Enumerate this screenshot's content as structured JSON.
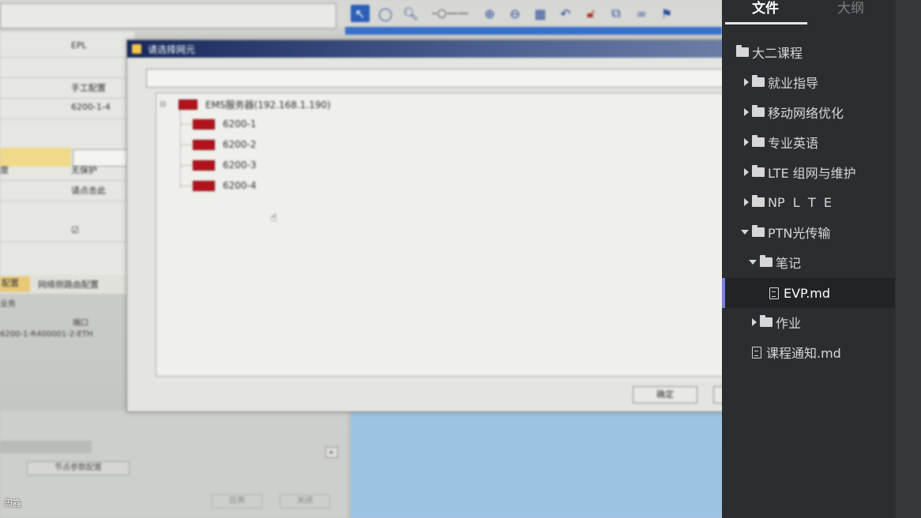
{
  "photo": {
    "left_panel": {
      "rows": [
        {
          "key": "",
          "value": "EPL"
        },
        {
          "key": "",
          "value": ""
        },
        {
          "key": "",
          "value": "手工配置"
        },
        {
          "key": "",
          "value": "6200-1-4"
        },
        {
          "key": "",
          "value": ""
        },
        {
          "key": "",
          "value": ""
        },
        {
          "key": "度",
          "value": "无保护"
        },
        {
          "key": "",
          "value": "请点击此"
        },
        {
          "key": "",
          "value": ""
        },
        {
          "key": "",
          "value": "☑"
        }
      ],
      "tab_active": "配置",
      "tab_other": "网络侧路由配置",
      "sub_header_left": "业务",
      "sub_header_right": "端口",
      "sub_value": "6200-1-R400001-2-ETH"
    },
    "dialog": {
      "title": "请选择网元",
      "tree_root": "EMS服务器(192.168.1.190)",
      "tree_children": [
        "6200-1",
        "6200-2",
        "6200-3",
        "6200-4"
      ],
      "ok_label": "确定"
    },
    "lower_button": "节点参数配置",
    "lower_btn_apply": "应用",
    "lower_btn_close": "关闭",
    "overlay_name": "周鑫"
  },
  "sidebar": {
    "tabs": {
      "files": "文件",
      "outline": "大纲"
    },
    "tree": [
      {
        "label": "大二课程"
      },
      {
        "label": "就业指导"
      },
      {
        "label": "移动网络优化"
      },
      {
        "label": "专业英语"
      },
      {
        "label": "LTE 组网与维护"
      },
      {
        "label": "NP  L  T  E"
      },
      {
        "label": "PTN光传输"
      },
      {
        "label": "笔记"
      },
      {
        "label": "EVP.md"
      },
      {
        "label": "作业"
      },
      {
        "label": "课程通知.md"
      }
    ]
  },
  "colors": {
    "sidebar_bg": "#2b2d31",
    "selected_accent": "#7b7fd6",
    "ne_icon": "#b3121c"
  }
}
